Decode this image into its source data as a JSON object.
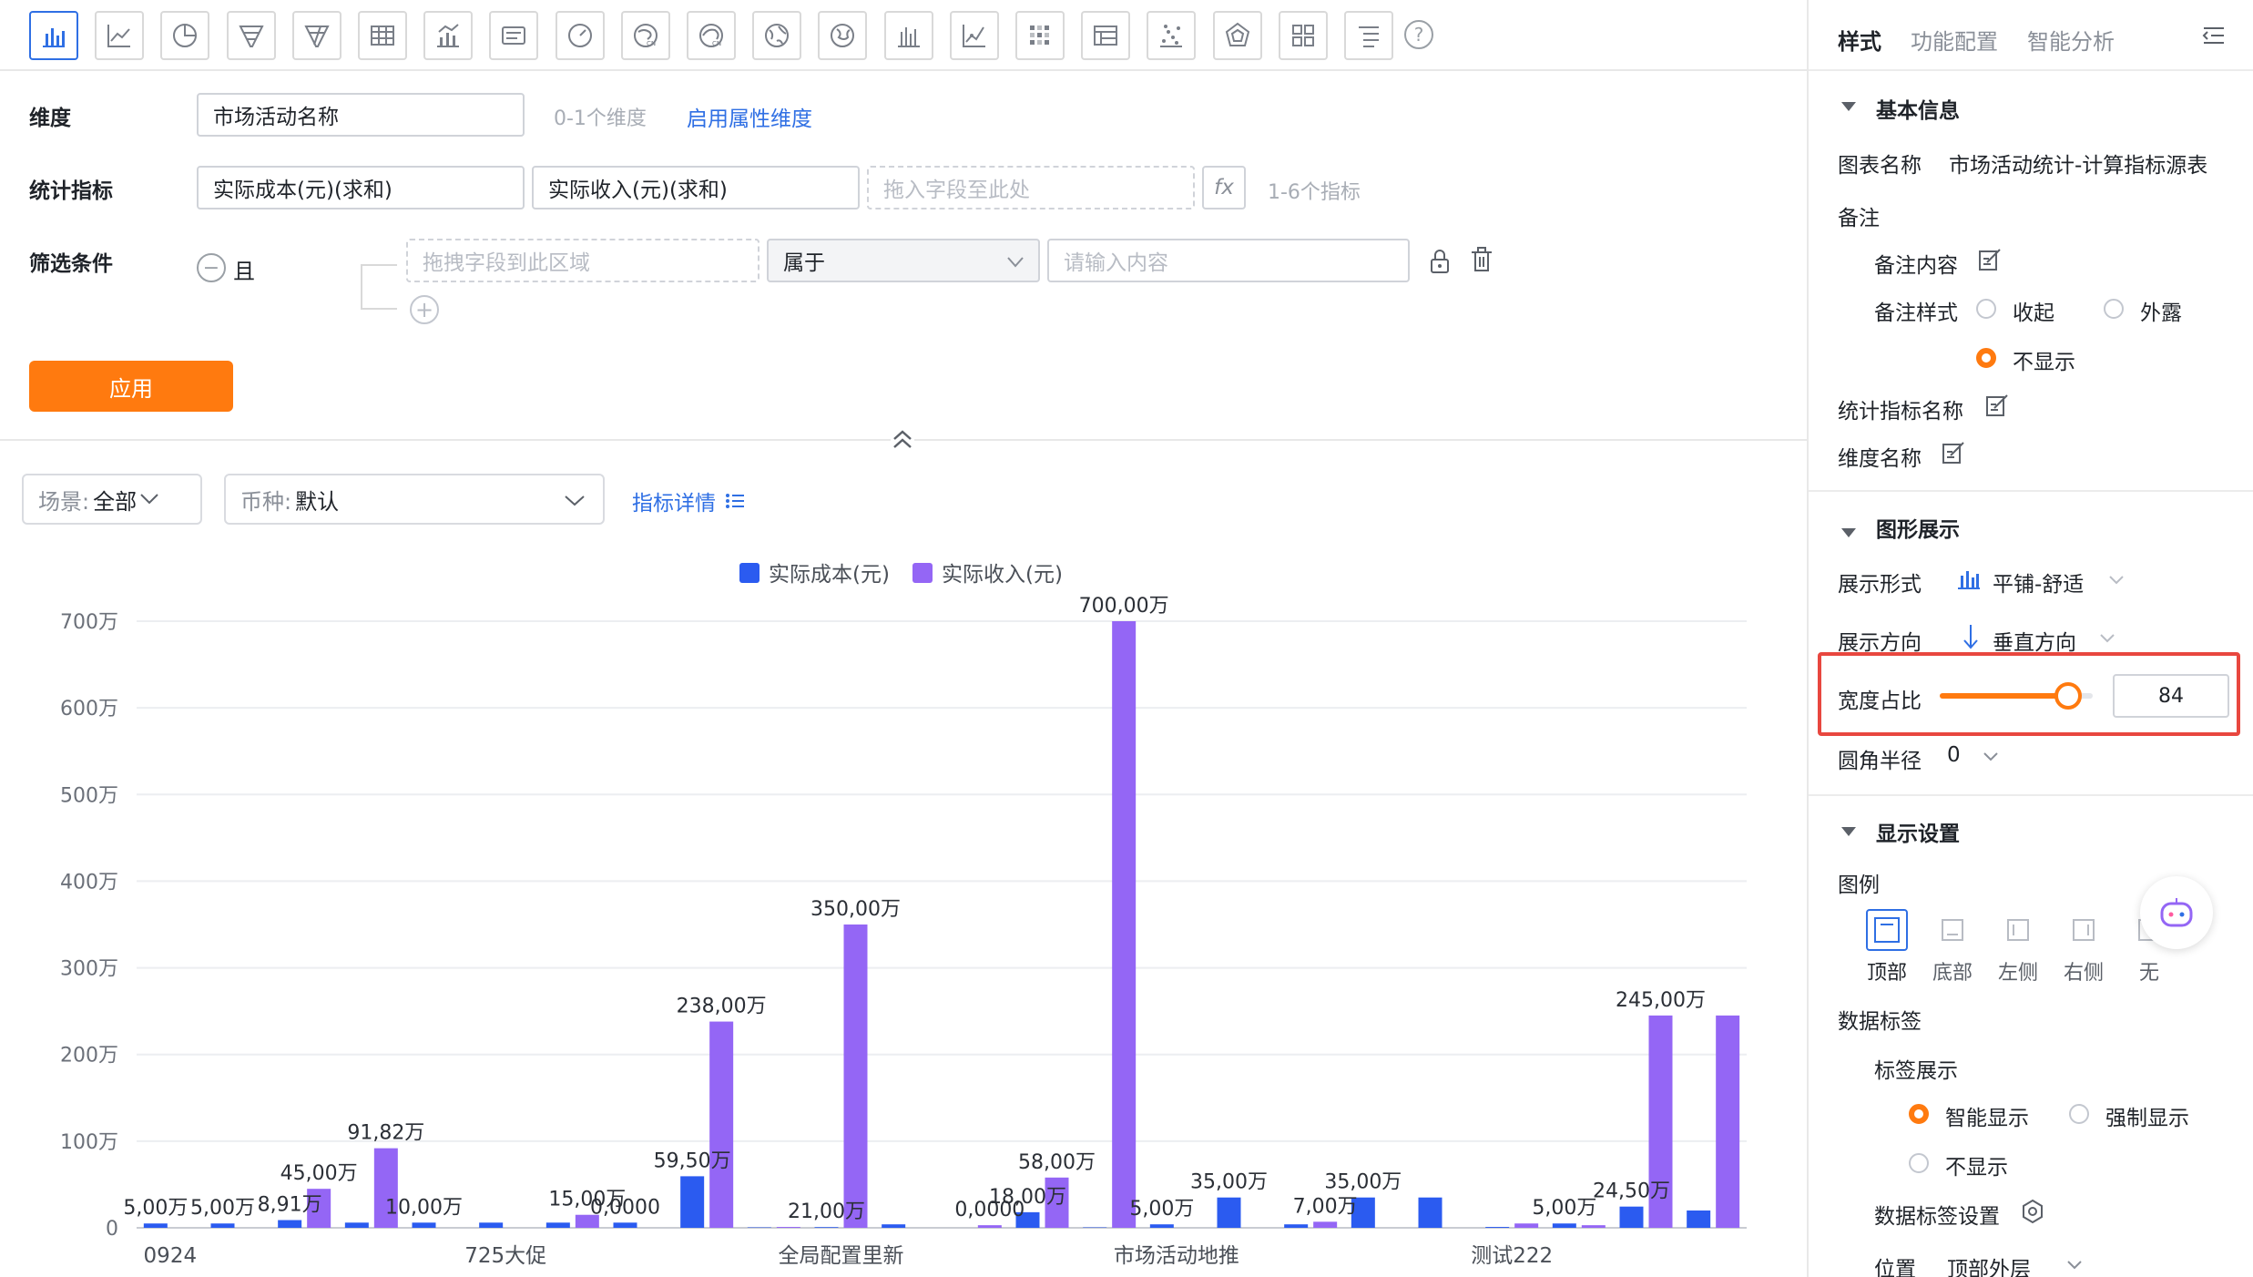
{
  "toolbar": {
    "icons": [
      "bar-chart-icon",
      "line-chart-icon",
      "pie-chart-icon",
      "funnel-icon",
      "funnel-compare-icon",
      "table-icon",
      "combo-chart-icon",
      "text-card-icon",
      "gauge-icon",
      "china-map-icon",
      "china-region-map-icon",
      "world-map-icon",
      "globe-map-icon",
      "histogram-icon",
      "scatter-line-icon",
      "heatmap-icon",
      "pivot-table-icon",
      "scatter-icon",
      "radar-icon",
      "card-grid-icon",
      "list-icon"
    ],
    "help": "?"
  },
  "form": {
    "dimension_label": "维度",
    "dimension_value": "市场活动名称",
    "dimension_hint": "0-1个维度",
    "dimension_link": "启用属性维度",
    "metric_label": "统计指标",
    "metrics": [
      "实际成本(元)(求和)",
      "实际收入(元)(求和)"
    ],
    "metric_drop_placeholder": "拖入字段至此处",
    "metric_hint": "1-6个指标",
    "fx": "fx",
    "filter_label": "筛选条件",
    "filter_logic": "且",
    "filter_drop_placeholder": "拖拽字段到此区域",
    "filter_operator": "属于",
    "filter_value_placeholder": "请输入内容",
    "apply": "应用"
  },
  "controls": {
    "scene_key": "场景:",
    "scene_value": "全部",
    "currency_key": "币种:",
    "currency_value": "默认",
    "metric_detail": "指标详情"
  },
  "colors": {
    "series_cost": "#2b5bf0",
    "series_income": "#9466f5",
    "accent": "#ff7a0f",
    "link": "#2f6fe4"
  },
  "chart_data": {
    "type": "bar",
    "legend_position": "top",
    "grid": true,
    "ylim": [
      0,
      700
    ],
    "y_unit": "万",
    "y_ticks": [
      "0",
      "100万",
      "200万",
      "300万",
      "400万",
      "500万",
      "600万",
      "700万"
    ],
    "categories": [
      "0924",
      "",
      "",
      "",
      "",
      "725大促",
      "",
      "",
      "",
      "",
      "全局配置里新",
      "",
      "",
      "",
      "",
      "市场活动地推",
      "",
      "",
      "",
      "",
      "测试222",
      "",
      "",
      ""
    ],
    "x_tick_labels": [
      {
        "index": 0,
        "label": "0924"
      },
      {
        "index": 5,
        "label": "725大促"
      },
      {
        "index": 10,
        "label": "全局配置里新"
      },
      {
        "index": 15,
        "label": "市场活动地推"
      },
      {
        "index": 20,
        "label": "测试222"
      }
    ],
    "series": [
      {
        "name": "实际成本(元)",
        "values": [
          5,
          5,
          8.91,
          6,
          6,
          6,
          6,
          6,
          59.5,
          0.5,
          0.8,
          4,
          0,
          18,
          0.5,
          4,
          35,
          4,
          35,
          35,
          1,
          5,
          24.5,
          20
        ]
      },
      {
        "name": "实际收入(元)",
        "values": [
          0,
          0,
          45,
          91.82,
          0,
          0,
          15,
          0,
          238,
          1,
          350,
          0,
          3,
          58,
          700,
          0,
          0,
          7,
          0,
          0,
          5,
          3,
          245,
          245
        ]
      }
    ],
    "data_labels": [
      {
        "index": 0,
        "series": 0,
        "text": "5,00万"
      },
      {
        "index": 1,
        "series": 0,
        "text": "5,00万"
      },
      {
        "index": 2,
        "series": 0,
        "text": "8,91万"
      },
      {
        "index": 2,
        "series": 1,
        "text": "45,00万"
      },
      {
        "index": 3,
        "series": 1,
        "text": "91,82万"
      },
      {
        "index": 4,
        "series": 0,
        "text": "10,00万"
      },
      {
        "index": 6,
        "series": 1,
        "text": "15,00万"
      },
      {
        "index": 7,
        "series": 0,
        "text": "0,0000"
      },
      {
        "index": 8,
        "series": 0,
        "text": "59,50万"
      },
      {
        "index": 8,
        "series": 1,
        "text": "238,00万"
      },
      {
        "index": 10,
        "series": 0,
        "text": "21,00万"
      },
      {
        "index": 10,
        "series": 1,
        "text": "350,00万"
      },
      {
        "index": 12,
        "series": 1,
        "text": "0,0000"
      },
      {
        "index": 13,
        "series": 0,
        "text": "18,00万"
      },
      {
        "index": 13,
        "series": 1,
        "text": "58,00万"
      },
      {
        "index": 14,
        "series": 1,
        "text": "700,00万"
      },
      {
        "index": 15,
        "series": 0,
        "text": "5,00万"
      },
      {
        "index": 16,
        "series": 0,
        "text": "35,00万"
      },
      {
        "index": 17,
        "series": 1,
        "text": "7,00万"
      },
      {
        "index": 18,
        "series": 0,
        "text": "35,00万"
      },
      {
        "index": 21,
        "series": 0,
        "text": "5,00万"
      },
      {
        "index": 22,
        "series": 0,
        "text": "24,50万"
      },
      {
        "index": 22,
        "series": 1,
        "text": "245,00万"
      }
    ]
  },
  "panel": {
    "tabs": [
      "样式",
      "功能配置",
      "智能分析"
    ],
    "basic": {
      "title": "基本信息",
      "chart_name_label": "图表名称",
      "chart_name_value": "市场活动统计-计算指标源表",
      "note_label": "备注",
      "note_content_label": "备注内容",
      "note_style_label": "备注样式",
      "note_style_options": [
        "收起",
        "外露",
        "不显示"
      ],
      "metric_name_label": "统计指标名称",
      "dimension_name_label": "维度名称"
    },
    "graphic": {
      "title": "图形展示",
      "display_form_label": "展示形式",
      "display_form_value": "平铺-舒适",
      "direction_label": "展示方向",
      "direction_value": "垂直方向",
      "width_ratio_label": "宽度占比",
      "width_ratio_value": "84",
      "width_ratio": 0.84,
      "corner_radius_label": "圆角半径",
      "corner_radius_value": "0"
    },
    "display": {
      "title": "显示设置",
      "legend_label": "图例",
      "legend_options": [
        "顶部",
        "底部",
        "左侧",
        "右侧",
        "无"
      ],
      "data_label_label": "数据标签",
      "label_display_label": "标签展示",
      "label_display_options": [
        "智能显示",
        "强制显示",
        "不显示"
      ],
      "data_label_settings": "数据标签设置",
      "position_label": "位置",
      "position_value": "顶部外层"
    }
  }
}
